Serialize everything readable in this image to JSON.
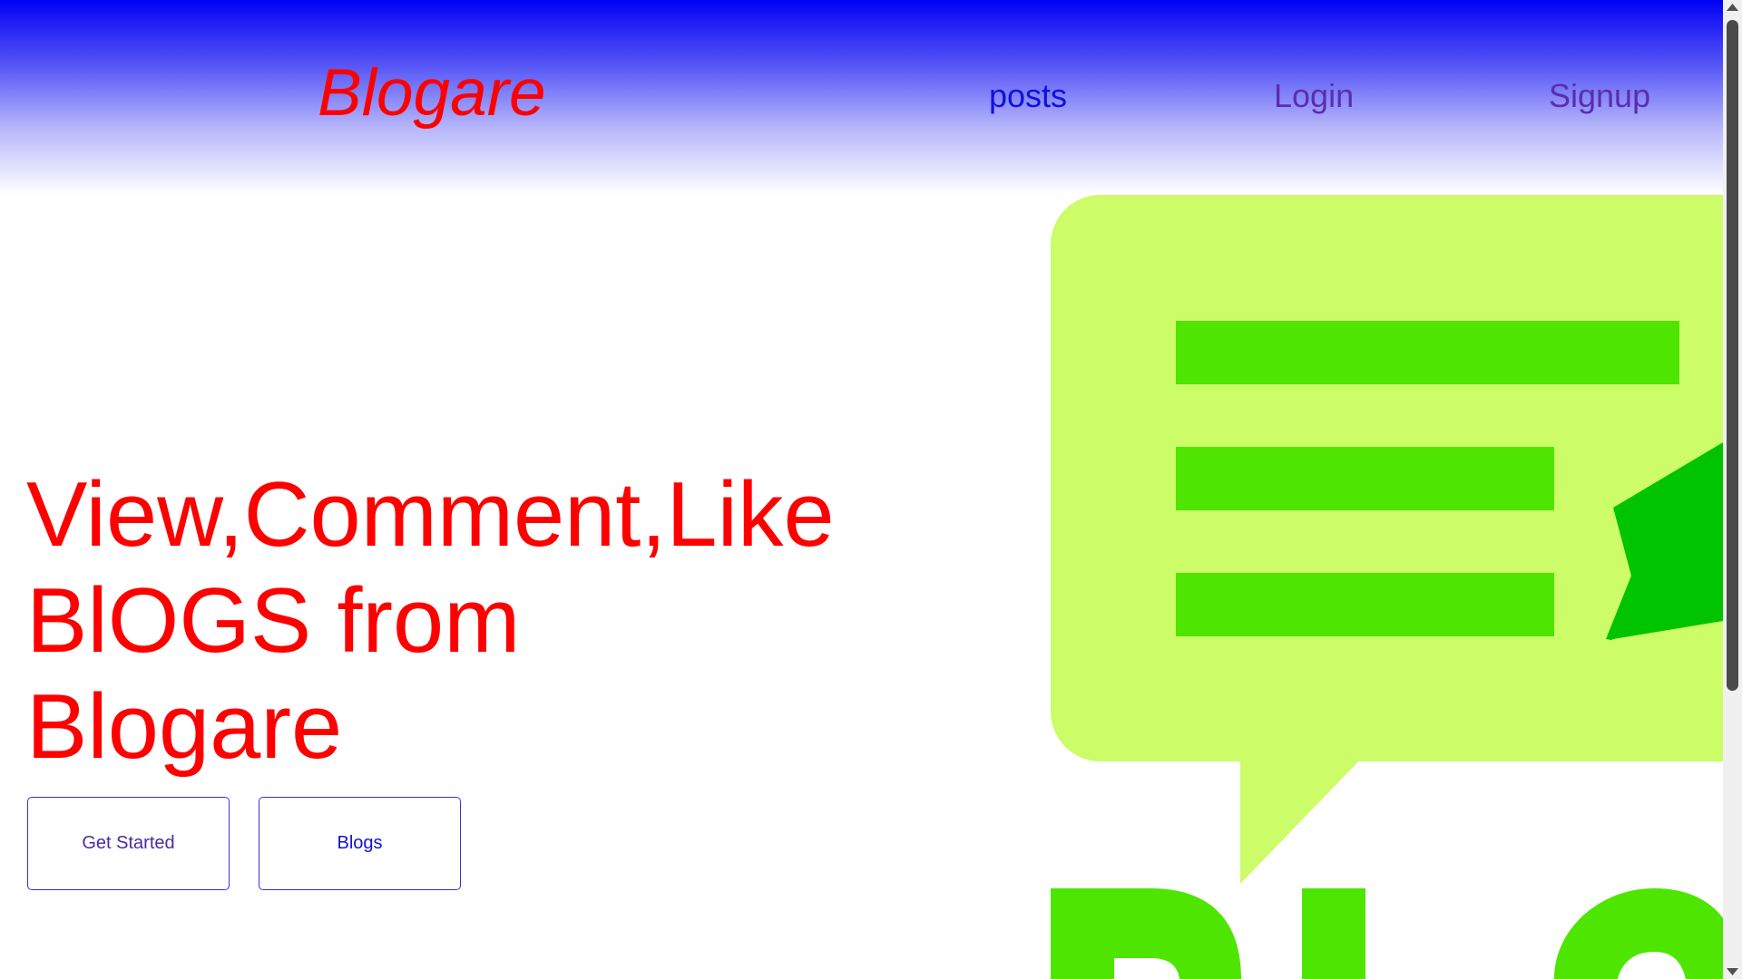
{
  "header": {
    "logo": "Blogare",
    "nav": {
      "posts": "posts",
      "login": "Login",
      "signup": "Signup"
    }
  },
  "hero": {
    "title_lines": [
      "View,Comment,Like",
      "BlOGS from",
      "Blogare"
    ],
    "buttons": {
      "get_started": "Get Started",
      "blogs": "Blogs"
    }
  },
  "colors": {
    "header_gradient_top": "#0000f5",
    "logo": "#ff0000",
    "hero_text": "#ff0000",
    "bubble_light": "#ccfc68",
    "bubble_lines": "#4ee600",
    "pen": "#00c400"
  }
}
